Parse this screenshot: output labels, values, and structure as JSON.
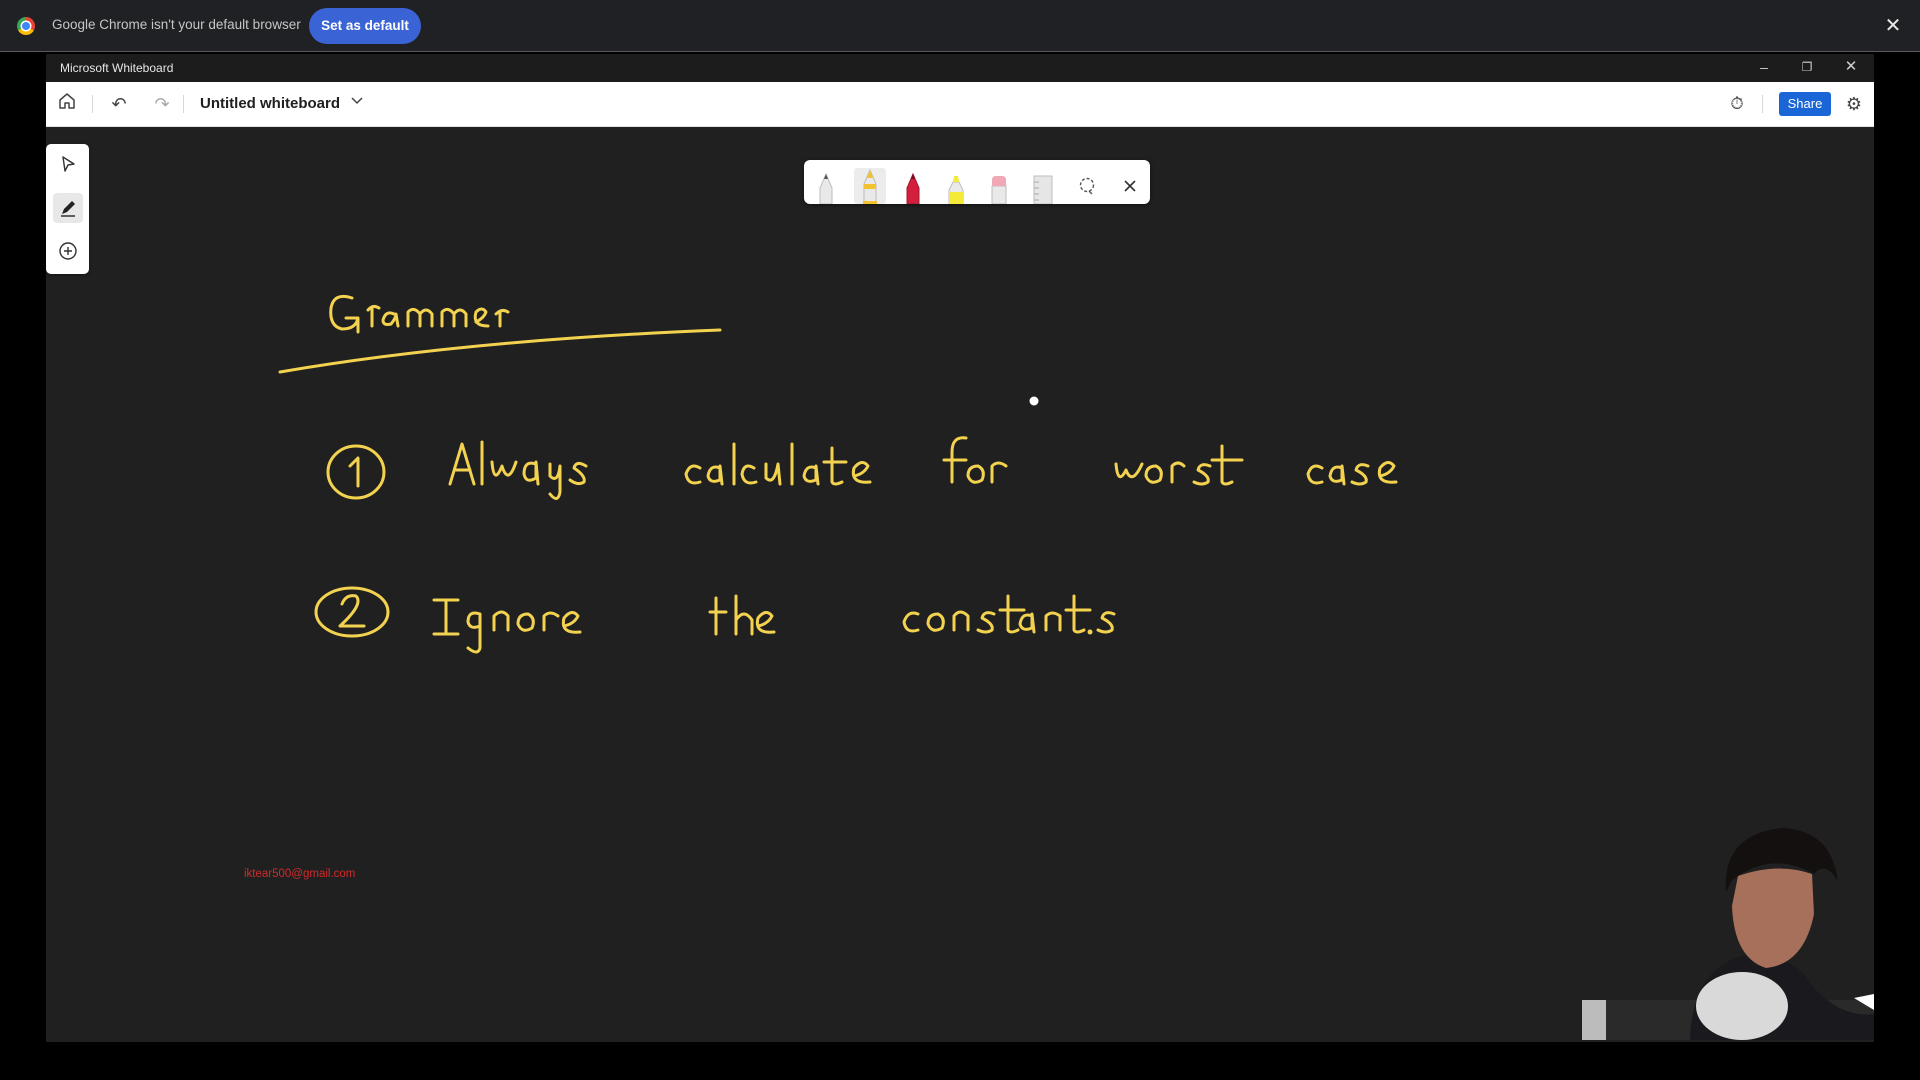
{
  "infobar": {
    "message": "Google Chrome isn't your default browser",
    "set_default_label": "Set as default",
    "close_icon": "close-icon"
  },
  "app": {
    "title": "Microsoft Whiteboard",
    "window_controls": [
      "minimize-icon",
      "restore-icon",
      "close-icon"
    ]
  },
  "toolbar": {
    "board_title": "Untitled whiteboard",
    "share_label": "Share",
    "icons": [
      "home-icon",
      "undo-icon",
      "redo-icon",
      "chevron-down-icon",
      "timer-icon",
      "gear-icon"
    ]
  },
  "left_rail": {
    "tools": [
      "select-arrow-icon",
      "ink-pen-icon",
      "add-plus-icon"
    ],
    "active": "ink-pen-icon"
  },
  "ink_tray": {
    "tools": [
      "pen-white",
      "pen-yellow",
      "pen-red",
      "highlighter-yellow",
      "eraser",
      "ruler",
      "lasso",
      "close"
    ],
    "selected": "pen-yellow",
    "colors": {
      "white": "#e9e9e9",
      "yellow": "#f2c230",
      "red": "#d31f3c",
      "highlighter": "#f5ea3a",
      "eraser": "#f0a8b6"
    }
  },
  "canvas": {
    "background": "#202020",
    "ink_color": "#f3d250",
    "handwriting": [
      "Grammer",
      "① Always calculate for worst case",
      "② Ignore the constants."
    ],
    "watermark": "iktear500@gmail.com"
  },
  "colors": {
    "accent": "#1a66d6",
    "set_default_button": "#3a63d6",
    "watermark_red": "#d12a2a"
  }
}
